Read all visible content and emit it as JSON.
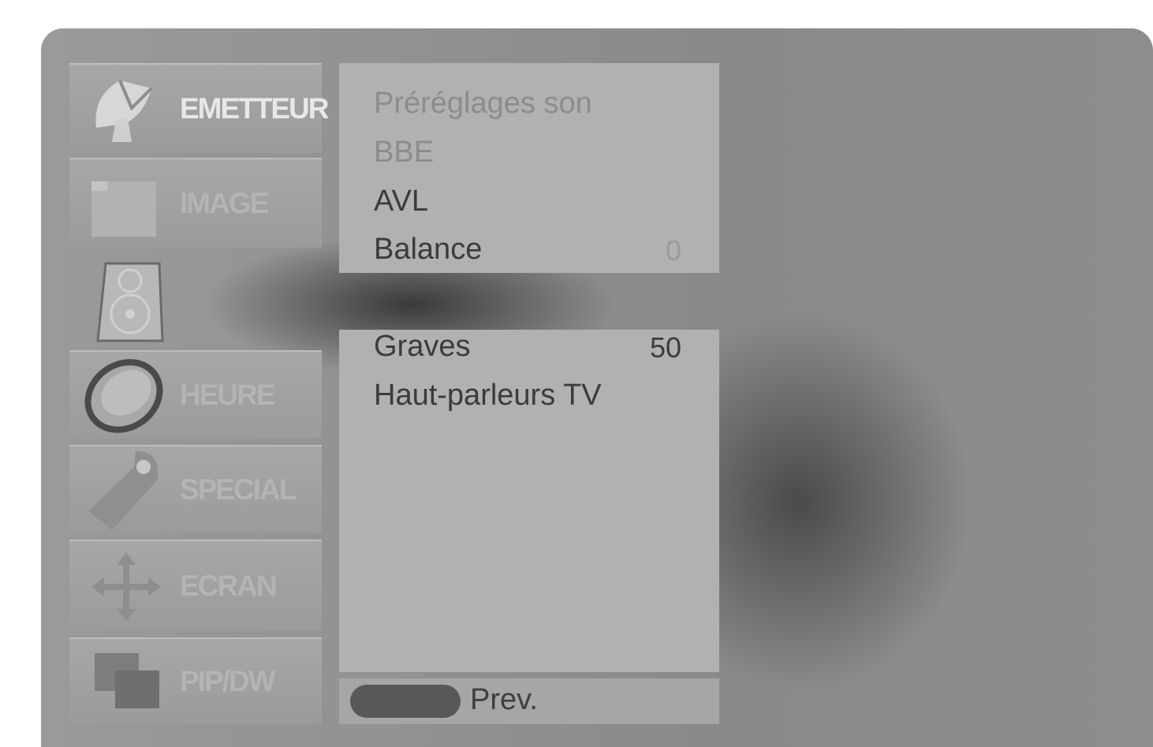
{
  "sidebar": {
    "tabs": [
      {
        "label": "EMETTEUR",
        "icon": "satellite-dish-icon",
        "active": true
      },
      {
        "label": "IMAGE",
        "icon": "picture-icon",
        "active": false
      },
      {
        "label": "",
        "icon": "speaker-icon",
        "active": false
      },
      {
        "label": "HEURE",
        "icon": "clock-icon",
        "active": false
      },
      {
        "label": "SPECIAL",
        "icon": "tag-icon",
        "active": false
      },
      {
        "label": "ECRAN",
        "icon": "move-arrows-icon",
        "active": false
      },
      {
        "label": "PIP/DW",
        "icon": "pip-windows-icon",
        "active": false
      }
    ]
  },
  "panel_top": {
    "items": [
      {
        "label": "Préréglages son",
        "value": ""
      },
      {
        "label": "BBE",
        "value": ""
      },
      {
        "label": "AVL",
        "value": ""
      },
      {
        "label": "Balance",
        "value": "0"
      }
    ]
  },
  "panel_bottom": {
    "items": [
      {
        "label": "Graves",
        "value": "50"
      },
      {
        "label": "Haut-parleurs TV",
        "value": ""
      }
    ]
  },
  "footer": {
    "prev_label": "Prev."
  },
  "colors": {
    "panel": "#b1b1b1",
    "frame": "#8a8a8a",
    "pill": "#585858"
  }
}
